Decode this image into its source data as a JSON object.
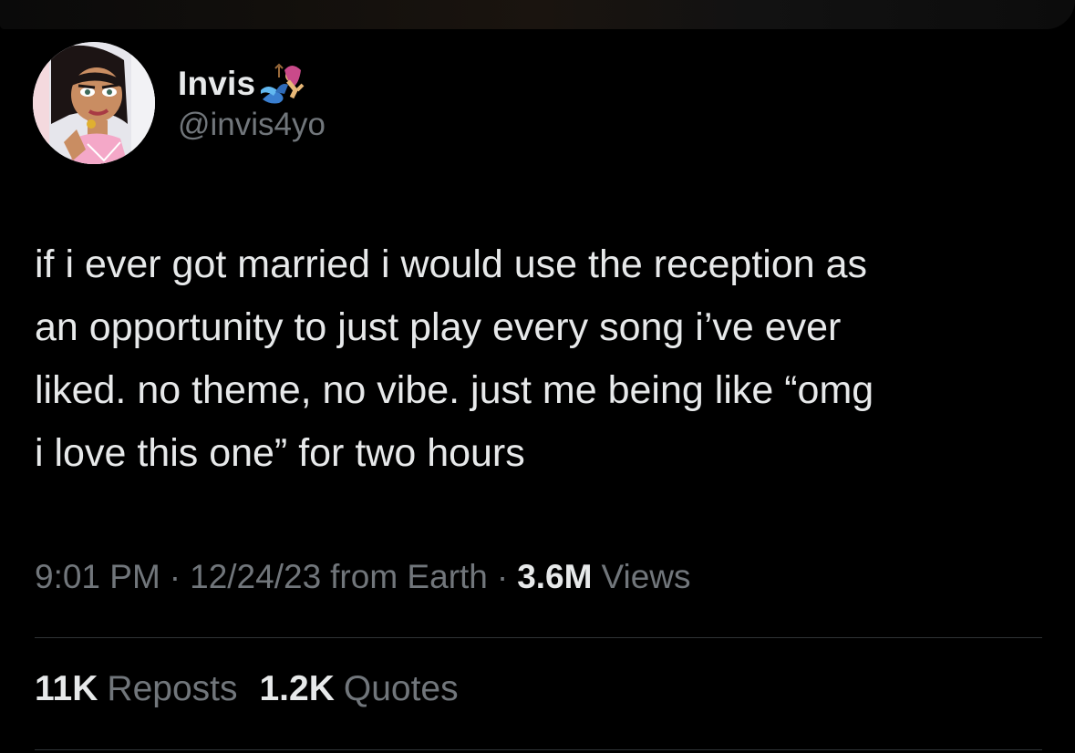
{
  "author": {
    "display_name": "Invis",
    "name_emoji": "merperson-emoji",
    "handle": "@invis4yo",
    "avatar": "cartoon-avatar"
  },
  "tweet": {
    "text": "if i ever got married i would use the reception as\nan opportunity to just play every song i’ve ever\nliked. no theme, no vibe. just me being like “omg\ni love this one” for two hours"
  },
  "meta": {
    "time": "9:01 PM",
    "separator": "·",
    "date": "12/24/23",
    "source": "from Earth",
    "views_count": "3.6M",
    "views_label": "Views"
  },
  "stats": {
    "reposts_count": "11K",
    "reposts_label": "Reposts",
    "quotes_count": "1.2K",
    "quotes_label": "Quotes"
  },
  "colors": {
    "background": "#000000",
    "primary_text": "#e7e9ea",
    "secondary_text": "#71767b",
    "divider": "#2f3336"
  }
}
